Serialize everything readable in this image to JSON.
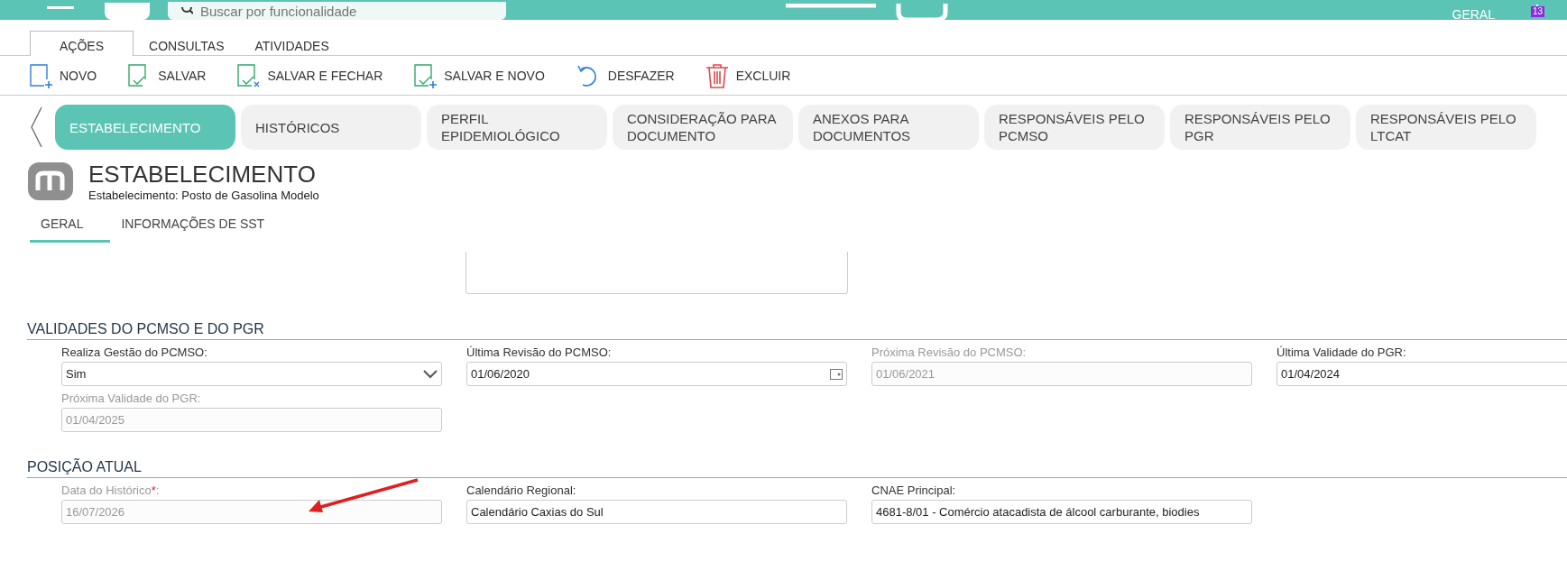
{
  "top_bar": {
    "search": {
      "placeholder": "Buscar por funcionalidade"
    },
    "user": "GERAL",
    "notification_count": "13"
  },
  "menu_tabs": [
    {
      "label": "AÇÕES",
      "selected": true
    },
    {
      "label": "CONSULTAS",
      "selected": false
    },
    {
      "label": "ATIVIDADES",
      "selected": false
    }
  ],
  "toolbar": [
    {
      "label": "NOVO",
      "kind": "new"
    },
    {
      "label": "SALVAR",
      "kind": "save"
    },
    {
      "label": "SALVAR E FECHAR",
      "kind": "save_close"
    },
    {
      "label": "SALVAR E NOVO",
      "kind": "save_new"
    },
    {
      "label": "DESFAZER",
      "kind": "undo"
    },
    {
      "label": "EXCLUIR",
      "kind": "delete"
    }
  ],
  "record_tabs": [
    {
      "label": "ESTABELECIMENTO",
      "selected": true
    },
    {
      "label": "HISTÓRICOS",
      "selected": false
    },
    {
      "label": "PERFIL EPIDEMIOLÓGICO",
      "selected": false
    },
    {
      "label": "CONSIDERAÇÃO PARA DOCUMENTO",
      "selected": false
    },
    {
      "label": "ANEXOS PARA DOCUMENTOS",
      "selected": false
    },
    {
      "label": "RESPONSÁVEIS PELO PCMSO",
      "selected": false
    },
    {
      "label": "RESPONSÁVEIS PELO PGR",
      "selected": false
    },
    {
      "label": "RESPONSÁVEIS PELO LTCAT",
      "selected": false
    }
  ],
  "header": {
    "title": "ESTABELECIMENTO",
    "subtitle": "Estabelecimento: Posto de Gasolina Modelo"
  },
  "sub_tabs": [
    {
      "label": "GERAL",
      "selected": true
    },
    {
      "label": "INFORMAÇÕES DE SST",
      "selected": false
    }
  ],
  "sections": [
    {
      "title": "VALIDADES DO PCMSO E DO PGR",
      "fields": [
        {
          "label": "Realiza Gestão do PCMSO:",
          "value": "Sim",
          "kind": "select",
          "disabled": false
        },
        {
          "label": "Última Revisão do PCMSO:",
          "value": "01/06/2020",
          "kind": "date",
          "disabled": false
        },
        {
          "label": "Próxima Revisão do PCMSO:",
          "value": "01/06/2021",
          "kind": "text",
          "disabled": true
        },
        {
          "label": "Última Validade do PGR:",
          "value": "01/04/2024",
          "kind": "text",
          "disabled": false
        },
        {
          "label": "Próxima Validade do PGR:",
          "value": "01/04/2025",
          "kind": "text",
          "disabled": true
        }
      ]
    },
    {
      "title": "POSIÇÃO ATUAL",
      "fields": [
        {
          "label": "Data do Histórico",
          "required_mark": "*",
          "label_end": ":",
          "value": "16/07/2026",
          "kind": "text",
          "disabled": true
        },
        {
          "label": "Calendário Regional:",
          "value": "Calendário Caxias do Sul",
          "kind": "text",
          "disabled": false
        },
        {
          "label": "CNAE Principal:",
          "value": "4681-8/01 - Comércio atacadista de álcool carburante, biodies",
          "kind": "text",
          "disabled": false
        }
      ]
    }
  ]
}
